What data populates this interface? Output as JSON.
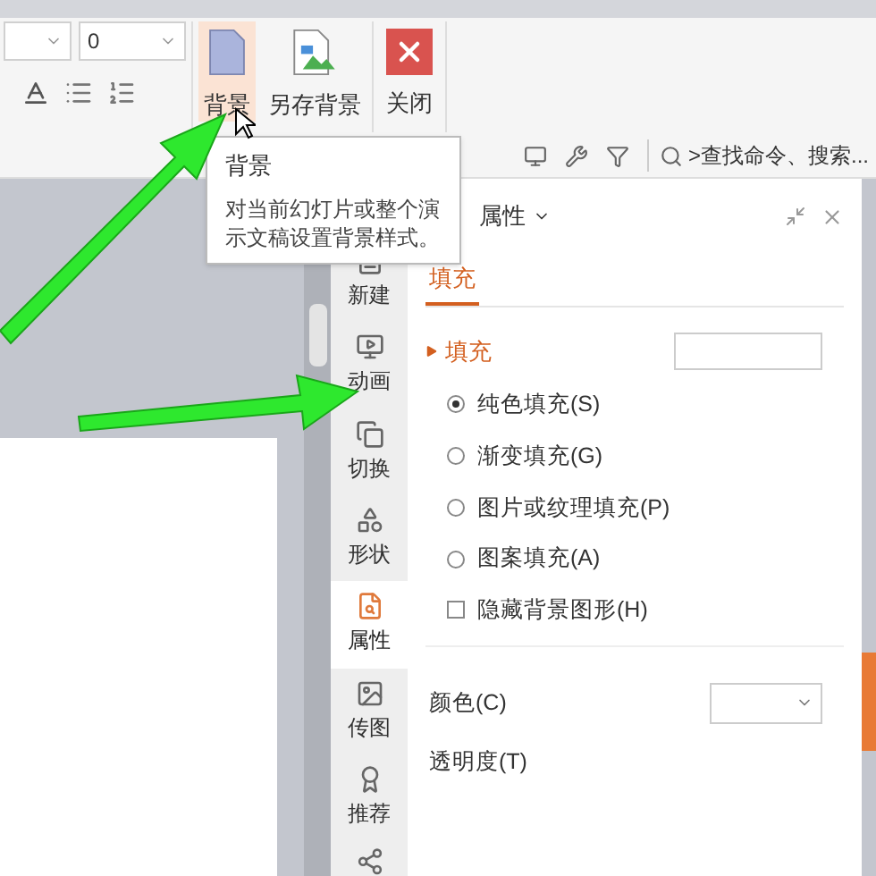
{
  "ribbon": {
    "size_field": {
      "value": "0"
    },
    "buttons": [
      {
        "label": "背景",
        "selected": true,
        "kind": "background"
      },
      {
        "label": "另存背景",
        "selected": false,
        "kind": "save"
      },
      {
        "label": "关闭",
        "selected": false,
        "kind": "close"
      }
    ]
  },
  "search": {
    "placeholder": ">查找命令、搜索..."
  },
  "tooltip": {
    "title": "背景",
    "description": "对当前幻灯片或整个演示文稿设置背景样式。"
  },
  "side_tabs": [
    {
      "label": "新建",
      "selected": false,
      "kind": "new"
    },
    {
      "label": "动画",
      "selected": false,
      "kind": "animation"
    },
    {
      "label": "切换",
      "selected": false,
      "kind": "transition"
    },
    {
      "label": "形状",
      "selected": false,
      "kind": "shape"
    },
    {
      "label": "属性",
      "selected": true,
      "kind": "properties"
    },
    {
      "label": "传图",
      "selected": false,
      "kind": "picture"
    },
    {
      "label": "推荐",
      "selected": false,
      "kind": "recommend"
    }
  ],
  "panel": {
    "title": "属性",
    "tabs": [
      {
        "label": "填充",
        "selected": true
      }
    ],
    "section": {
      "title": "填充",
      "expanded": true
    },
    "fill_options": [
      {
        "label": "纯色填充(S)",
        "selected": true
      },
      {
        "label": "渐变填充(G)",
        "selected": false
      },
      {
        "label": "图片或纹理填充(P)",
        "selected": false
      },
      {
        "label": "图案填充(A)",
        "selected": false
      }
    ],
    "hide_graphics": {
      "label": "隐藏背景图形(H)",
      "checked": false
    },
    "color": {
      "label": "颜色(C)"
    },
    "transparency": {
      "label": "透明度(T)"
    }
  }
}
